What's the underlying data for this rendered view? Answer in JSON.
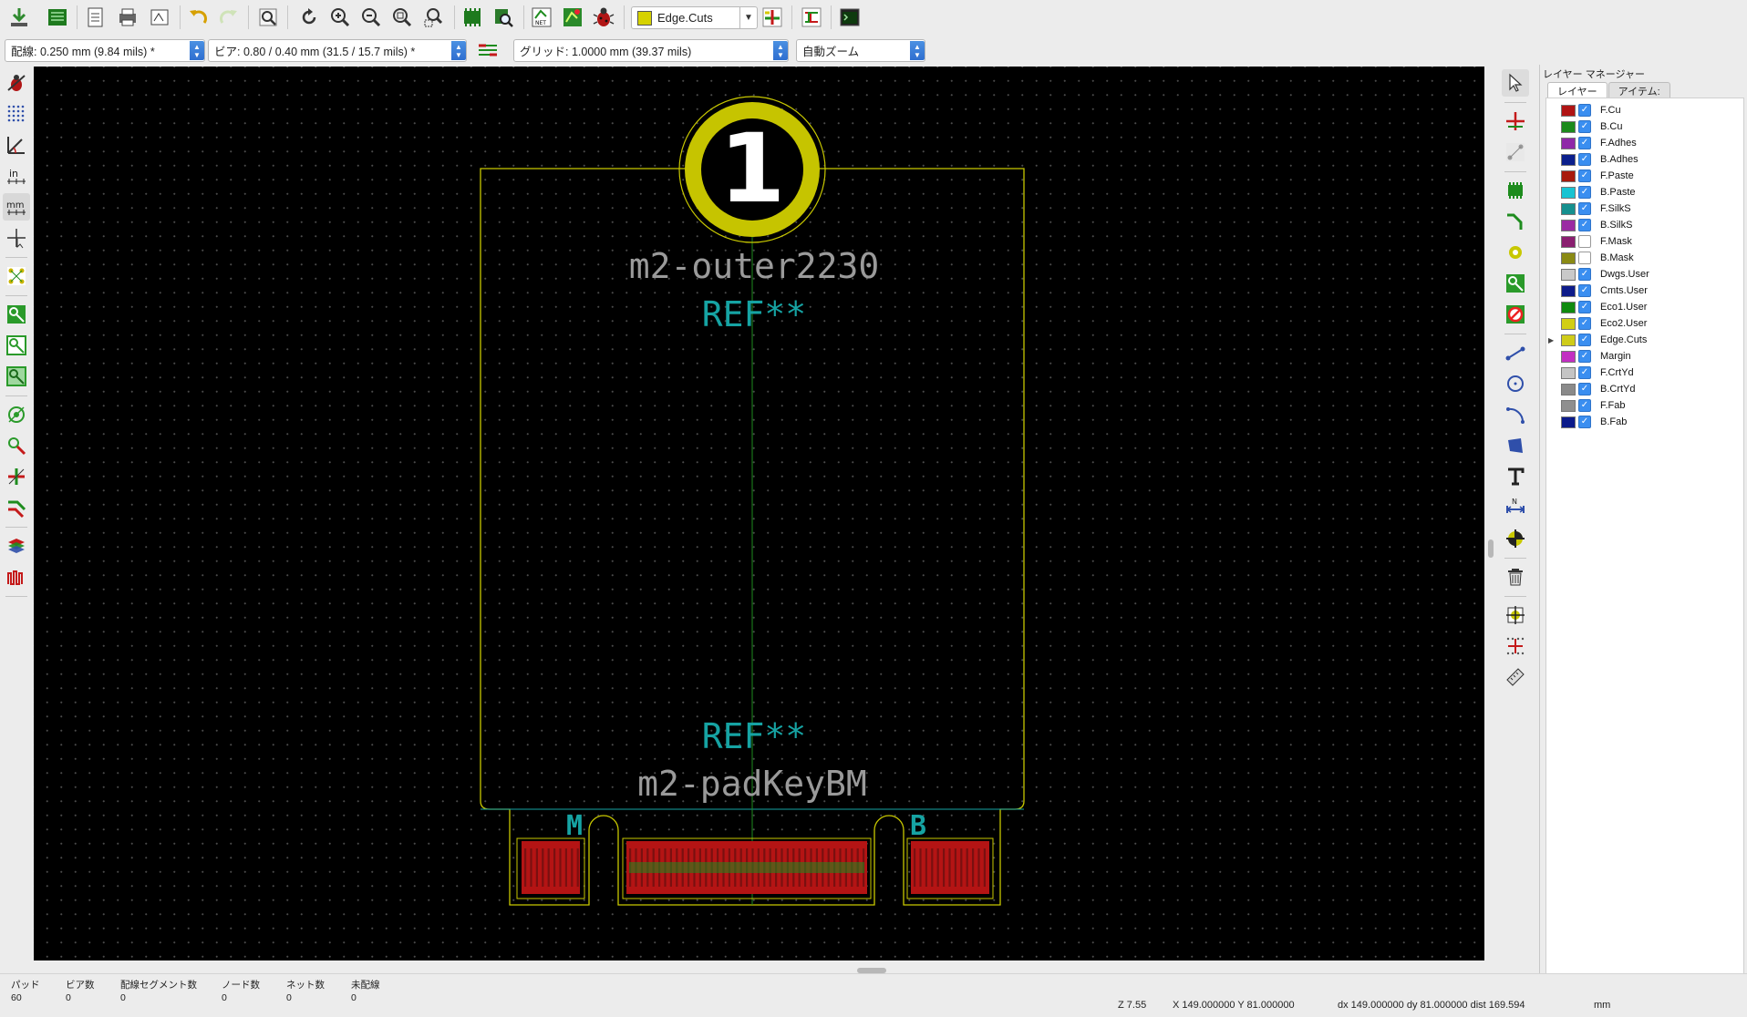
{
  "toolbar_top": {
    "active_layer": "Edge.Cuts",
    "icons": [
      "save-board-icon",
      "pcb-page-icon",
      "new-page-icon",
      "print-icon",
      "plot-icon",
      "undo-icon",
      "redo-icon",
      "find-icon",
      "refresh-icon",
      "zoom-in-icon",
      "zoom-out-icon",
      "zoom-fit-icon",
      "zoom-selection-icon",
      "footprint-editor-icon",
      "footprint-viewer-icon",
      "netlist-icon",
      "update-pcb-icon",
      "drc-icon",
      "layer-pair-icon",
      "autoroute-icon",
      "scripting-console-icon"
    ]
  },
  "toolbar_second": {
    "track_width": "配線: 0.250 mm (9.84 mils) *",
    "via_size": "ビア: 0.80 / 0.40 mm (31.5 / 15.7 mils) *",
    "grid": "グリッド: 1.0000 mm (39.37 mils)",
    "zoom": "自動ズーム"
  },
  "canvas": {
    "board_badge": "1",
    "value_top": "m2-outer2230",
    "ref_top": "REF**",
    "ref_bottom": "REF**",
    "value_bottom": "m2-padKeyBM",
    "key_m": "M",
    "key_b": "B",
    "colors": {
      "edge_cuts": "#c8c800",
      "silk_text": "#9a9a9a",
      "ref_text": "#16a3a3",
      "pad_red": "#b41414",
      "pad_green": "#1e8c1e"
    }
  },
  "layer_manager": {
    "title": "レイヤー マネージャー",
    "tabs": [
      "レイヤー",
      "アイテム:"
    ],
    "layers": [
      {
        "name": "F.Cu",
        "color": "#b01414",
        "checked": true
      },
      {
        "name": "B.Cu",
        "color": "#1c8a1c",
        "checked": true
      },
      {
        "name": "F.Adhes",
        "color": "#8f28a8",
        "checked": true
      },
      {
        "name": "B.Adhes",
        "color": "#0b1f8c",
        "checked": true
      },
      {
        "name": "F.Paste",
        "color": "#a81a0c",
        "checked": true
      },
      {
        "name": "B.Paste",
        "color": "#18c3d2",
        "checked": true
      },
      {
        "name": "F.SilkS",
        "color": "#15908f",
        "checked": true
      },
      {
        "name": "B.SilkS",
        "color": "#9a2aa3",
        "checked": true
      },
      {
        "name": "F.Mask",
        "color": "#8a1f70",
        "checked": false
      },
      {
        "name": "B.Mask",
        "color": "#8a8a14",
        "checked": false
      },
      {
        "name": "Dwgs.User",
        "color": "#c9c9c9",
        "checked": true
      },
      {
        "name": "Cmts.User",
        "color": "#0d1b8a",
        "checked": true
      },
      {
        "name": "Eco1.User",
        "color": "#0f8a0f",
        "checked": true
      },
      {
        "name": "Eco2.User",
        "color": "#d2ce14",
        "checked": true
      },
      {
        "name": "Edge.Cuts",
        "color": "#cfcc19",
        "checked": true,
        "active": true
      },
      {
        "name": "Margin",
        "color": "#c22fc2",
        "checked": true
      },
      {
        "name": "F.CrtYd",
        "color": "#c4c4c4",
        "checked": true
      },
      {
        "name": "B.CrtYd",
        "color": "#8a8a8a",
        "checked": true
      },
      {
        "name": "F.Fab",
        "color": "#8f8f8f",
        "checked": true
      },
      {
        "name": "B.Fab",
        "color": "#0b1a8a",
        "checked": true
      }
    ]
  },
  "status": {
    "pads_label": "パッド",
    "pads_value": "60",
    "vias_label": "ビア数",
    "vias_value": "0",
    "segments_label": "配線セグメント数",
    "segments_value": "0",
    "nodes_label": "ノード数",
    "nodes_value": "0",
    "nets_label": "ネット数",
    "nets_value": "0",
    "unrouted_label": "未配線",
    "unrouted_value": "0",
    "zoom": "Z 7.55",
    "xy": "X 149.000000  Y 81.000000",
    "dxdy": "dx 149.000000  dy 81.000000  dist 169.594",
    "units": "mm"
  }
}
